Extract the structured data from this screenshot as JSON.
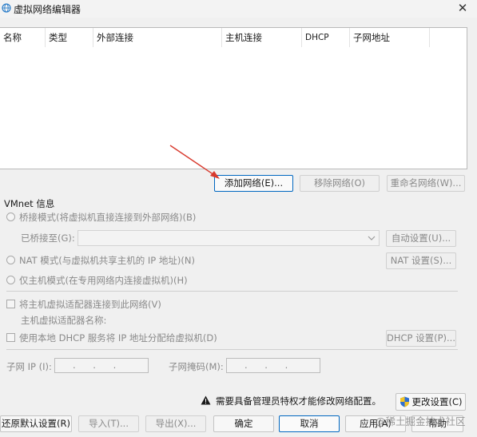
{
  "window": {
    "title": "虚拟网络编辑器",
    "close_glyph": "✕"
  },
  "table": {
    "columns": [
      "名称",
      "类型",
      "外部连接",
      "主机连接",
      "DHCP",
      "子网地址"
    ],
    "rows": []
  },
  "list_buttons": {
    "add": "添加网络(E)...",
    "remove": "移除网络(O)",
    "rename": "重命名网络(W)..."
  },
  "vmnet": {
    "group_label": "VMnet 信息",
    "bridged_radio": "桥接模式(将虚拟机直接连接到外部网络)(B)",
    "bridged_to_label": "已桥接至(G):",
    "bridged_to_value": "",
    "auto_settings": "自动设置(U)...",
    "nat_radio": "NAT 模式(与虚拟机共享主机的 IP 地址)(N)",
    "nat_settings": "NAT 设置(S)...",
    "host_only_radio": "仅主机模式(在专用网络内连接虚拟机)(H)",
    "connect_adapter_check": "将主机虚拟适配器连接到此网络(V)",
    "adapter_name_label": "主机虚拟适配器名称:",
    "dhcp_check": "使用本地 DHCP 服务将 IP 地址分配给虚拟机(D)",
    "dhcp_settings": "DHCP 设置(P)...",
    "subnet_ip_label": "子网 IP (I):",
    "subnet_ip_value": "  .    .    .  ",
    "subnet_mask_label": "子网掩码(M):",
    "subnet_mask_value": "  .    .    .  "
  },
  "admin": {
    "warning": "需要具备管理员特权才能修改网络配置。",
    "change_settings": "更改设置(C)"
  },
  "footer": {
    "restore": "还原默认设置(R)",
    "import": "导入(T)...",
    "export": "导出(X)...",
    "ok": "确定",
    "cancel": "取消",
    "apply": "应用(A)",
    "help": "帮助",
    "watermark": "@稀土掘金技术社区"
  },
  "colors": {
    "accent": "#0067c0",
    "arrow": "#d83a2e",
    "disabled_text": "#8a8a8a"
  }
}
